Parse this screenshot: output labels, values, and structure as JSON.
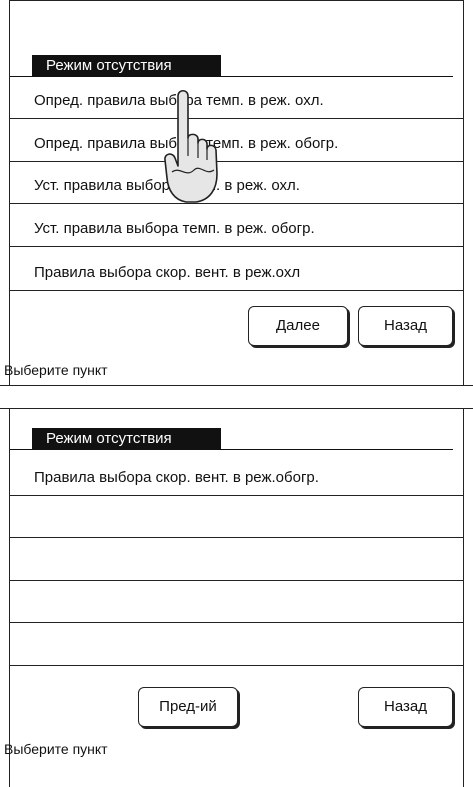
{
  "screen1": {
    "header": "Режим отсутствия",
    "items": [
      {
        "label": "Опред. правила выбора темп. в реж. охл."
      },
      {
        "label": "Опред. правила выбора темп. в реж. обогр."
      },
      {
        "label": "Уст. правила выбора темп. в реж. охл."
      },
      {
        "label": "Уст. правила выбора темп. в реж. обогр."
      },
      {
        "label": "Правила выбора скор. вент. в реж.охл"
      }
    ],
    "next_button": "Далее",
    "back_button": "Назад",
    "status": "Выберите пункт"
  },
  "screen2": {
    "header": "Режим отсутствия",
    "items": [
      {
        "label": "Правила выбора скор. вент. в реж.обогр."
      },
      {
        "label": ""
      },
      {
        "label": ""
      },
      {
        "label": ""
      },
      {
        "label": ""
      }
    ],
    "prev_button": "Пред-ий",
    "back_button": "Назад",
    "status": "Выберите пункт"
  },
  "overlay": {
    "pointer_icon": "hand-pointer-icon"
  }
}
